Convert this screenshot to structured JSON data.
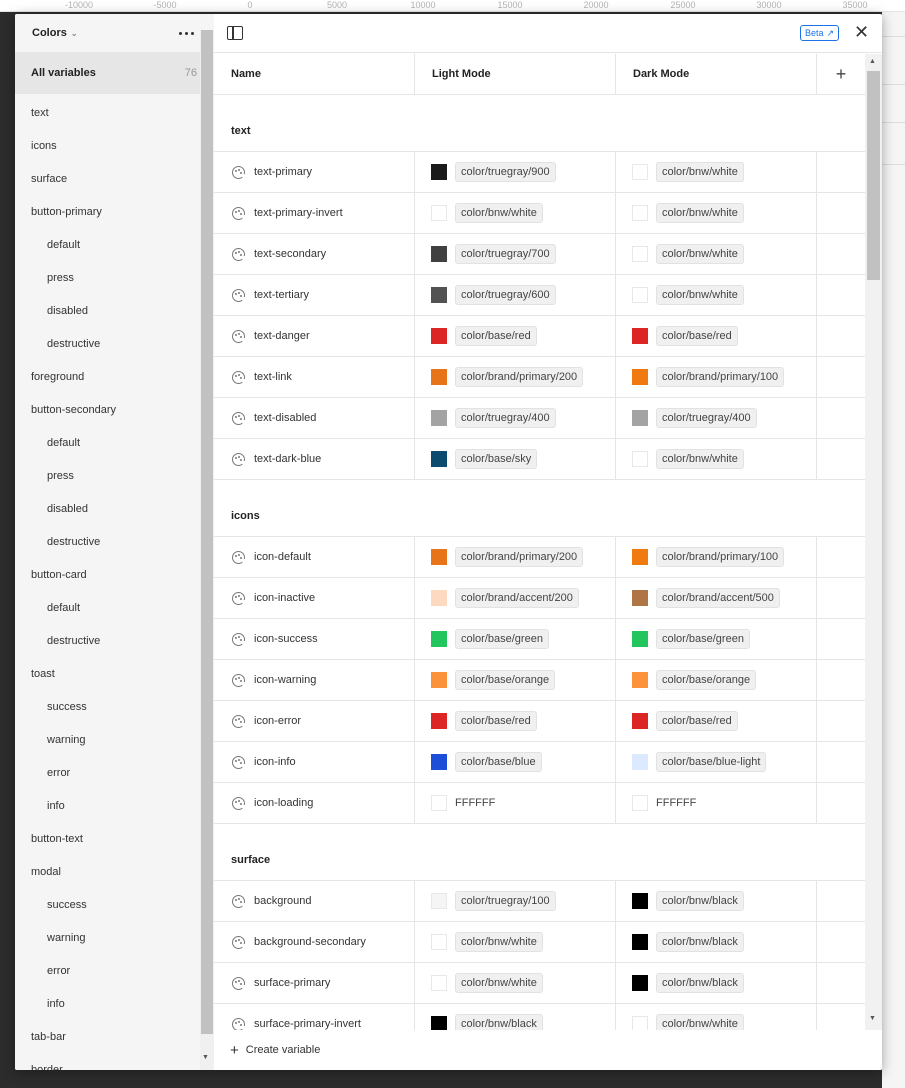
{
  "ruler": [
    "-10000",
    "-5000",
    "0",
    "5000",
    "10000",
    "15000",
    "20000",
    "25000",
    "30000",
    "35000"
  ],
  "sidebar": {
    "collection": "Colors",
    "all_label": "All variables",
    "all_count": "76",
    "groups": [
      {
        "label": "text",
        "sub": false
      },
      {
        "label": "icons",
        "sub": false
      },
      {
        "label": "surface",
        "sub": false
      },
      {
        "label": "button-primary",
        "sub": false
      },
      {
        "label": "default",
        "sub": true
      },
      {
        "label": "press",
        "sub": true
      },
      {
        "label": "disabled",
        "sub": true
      },
      {
        "label": "destructive",
        "sub": true
      },
      {
        "label": "foreground",
        "sub": false
      },
      {
        "label": "button-secondary",
        "sub": false
      },
      {
        "label": "default",
        "sub": true
      },
      {
        "label": "press",
        "sub": true
      },
      {
        "label": "disabled",
        "sub": true
      },
      {
        "label": "destructive",
        "sub": true
      },
      {
        "label": "button-card",
        "sub": false
      },
      {
        "label": "default",
        "sub": true
      },
      {
        "label": "destructive",
        "sub": true
      },
      {
        "label": "toast",
        "sub": false
      },
      {
        "label": "success",
        "sub": true
      },
      {
        "label": "warning",
        "sub": true
      },
      {
        "label": "error",
        "sub": true
      },
      {
        "label": "info",
        "sub": true
      },
      {
        "label": "button-text",
        "sub": false
      },
      {
        "label": "modal",
        "sub": false
      },
      {
        "label": "success",
        "sub": true
      },
      {
        "label": "warning",
        "sub": true
      },
      {
        "label": "error",
        "sub": true
      },
      {
        "label": "info",
        "sub": true
      },
      {
        "label": "tab-bar",
        "sub": false
      },
      {
        "label": "border",
        "sub": false
      }
    ]
  },
  "header": {
    "beta_label": "Beta",
    "close_icon": "close-icon",
    "panel_icon": "sidebar-toggle-icon"
  },
  "columns": {
    "name": "Name",
    "light": "Light Mode",
    "dark": "Dark Mode",
    "add": "+"
  },
  "groups": [
    {
      "title": "text",
      "rows": [
        {
          "name": "text-primary",
          "light": {
            "color": "#1a1a1a",
            "label": "color/truegray/900",
            "pill": true
          },
          "dark": {
            "color": "#ffffff",
            "label": "color/bnw/white",
            "pill": true
          }
        },
        {
          "name": "text-primary-invert",
          "light": {
            "color": "#ffffff",
            "label": "color/bnw/white",
            "pill": true
          },
          "dark": {
            "color": "#ffffff",
            "label": "color/bnw/white",
            "pill": true
          }
        },
        {
          "name": "text-secondary",
          "light": {
            "color": "#404040",
            "label": "color/truegray/700",
            "pill": true
          },
          "dark": {
            "color": "#ffffff",
            "label": "color/bnw/white",
            "pill": true
          }
        },
        {
          "name": "text-tertiary",
          "light": {
            "color": "#525252",
            "label": "color/truegray/600",
            "pill": true
          },
          "dark": {
            "color": "#ffffff",
            "label": "color/bnw/white",
            "pill": true
          }
        },
        {
          "name": "text-danger",
          "light": {
            "color": "#dc2626",
            "label": "color/base/red",
            "pill": true
          },
          "dark": {
            "color": "#dc2626",
            "label": "color/base/red",
            "pill": true
          }
        },
        {
          "name": "text-link",
          "light": {
            "color": "#e8741a",
            "label": "color/brand/primary/200",
            "pill": true
          },
          "dark": {
            "color": "#f07a10",
            "label": "color/brand/primary/100",
            "pill": true
          }
        },
        {
          "name": "text-disabled",
          "light": {
            "color": "#a3a3a3",
            "label": "color/truegray/400",
            "pill": true
          },
          "dark": {
            "color": "#a3a3a3",
            "label": "color/truegray/400",
            "pill": true
          }
        },
        {
          "name": "text-dark-blue",
          "light": {
            "color": "#0c4a6e",
            "label": "color/base/sky",
            "pill": true
          },
          "dark": {
            "color": "#ffffff",
            "label": "color/bnw/white",
            "pill": true
          }
        }
      ]
    },
    {
      "title": "icons",
      "rows": [
        {
          "name": "icon-default",
          "light": {
            "color": "#e8741a",
            "label": "color/brand/primary/200",
            "pill": true
          },
          "dark": {
            "color": "#f07a10",
            "label": "color/brand/primary/100",
            "pill": true
          }
        },
        {
          "name": "icon-inactive",
          "light": {
            "color": "#fcd9c0",
            "label": "color/brand/accent/200",
            "pill": true
          },
          "dark": {
            "color": "#b07545",
            "label": "color/brand/accent/500",
            "pill": true
          }
        },
        {
          "name": "icon-success",
          "light": {
            "color": "#22c55e",
            "label": "color/base/green",
            "pill": true
          },
          "dark": {
            "color": "#22c55e",
            "label": "color/base/green",
            "pill": true
          }
        },
        {
          "name": "icon-warning",
          "light": {
            "color": "#fb923c",
            "label": "color/base/orange",
            "pill": true
          },
          "dark": {
            "color": "#fb923c",
            "label": "color/base/orange",
            "pill": true
          }
        },
        {
          "name": "icon-error",
          "light": {
            "color": "#dc2626",
            "label": "color/base/red",
            "pill": true
          },
          "dark": {
            "color": "#dc2626",
            "label": "color/base/red",
            "pill": true
          }
        },
        {
          "name": "icon-info",
          "light": {
            "color": "#1d4ed8",
            "label": "color/base/blue",
            "pill": true
          },
          "dark": {
            "color": "#dbeafe",
            "label": "color/base/blue-light",
            "pill": true
          }
        },
        {
          "name": "icon-loading",
          "light": {
            "color": "#ffffff",
            "label": "FFFFFF",
            "pill": false
          },
          "dark": {
            "color": "#ffffff",
            "label": "FFFFFF",
            "pill": false
          }
        }
      ]
    },
    {
      "title": "surface",
      "rows": [
        {
          "name": "background",
          "light": {
            "color": "#f5f5f5",
            "label": "color/truegray/100",
            "pill": true
          },
          "dark": {
            "color": "#000000",
            "label": "color/bnw/black",
            "pill": true
          }
        },
        {
          "name": "background-secondary",
          "light": {
            "color": "#ffffff",
            "label": "color/bnw/white",
            "pill": true
          },
          "dark": {
            "color": "#000000",
            "label": "color/bnw/black",
            "pill": true
          }
        },
        {
          "name": "surface-primary",
          "light": {
            "color": "#ffffff",
            "label": "color/bnw/white",
            "pill": true
          },
          "dark": {
            "color": "#000000",
            "label": "color/bnw/black",
            "pill": true
          }
        },
        {
          "name": "surface-primary-invert",
          "light": {
            "color": "#000000",
            "label": "color/bnw/black",
            "pill": true
          },
          "dark": {
            "color": "#ffffff",
            "label": "color/bnw/white",
            "pill": true
          }
        }
      ]
    }
  ],
  "footer": {
    "create_label": "Create variable"
  }
}
